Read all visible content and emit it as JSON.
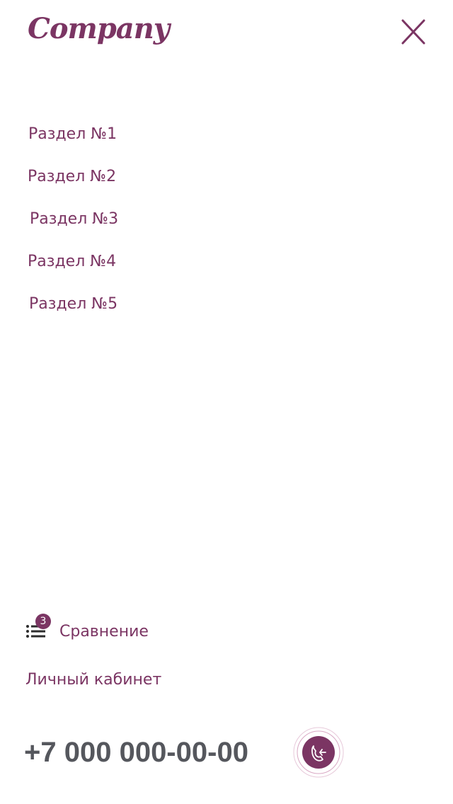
{
  "header": {
    "logo_text": "Company",
    "close_icon": "close-icon"
  },
  "nav": {
    "items": [
      {
        "label": "Раздел №1"
      },
      {
        "label": "Раздел №2"
      },
      {
        "label": "Раздел №3"
      },
      {
        "label": "Раздел №4"
      },
      {
        "label": "Раздел №5"
      }
    ]
  },
  "compare": {
    "icon": "list-icon",
    "badge_count": "3",
    "label": "Сравнение"
  },
  "account": {
    "label": "Личный кабинет"
  },
  "contact": {
    "phone": "+7 000 000-00-00",
    "callback_icon": "phone-callback-icon"
  },
  "colors": {
    "accent": "#7b3563",
    "phone_text": "#55575d",
    "background": "#ffffff"
  }
}
